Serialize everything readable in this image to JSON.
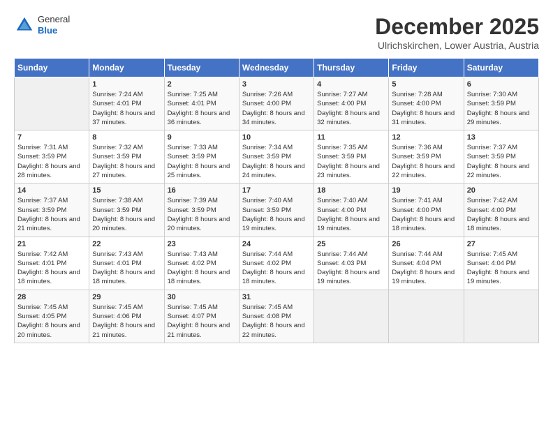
{
  "header": {
    "logo_general": "General",
    "logo_blue": "Blue",
    "month": "December 2025",
    "location": "Ulrichskirchen, Lower Austria, Austria"
  },
  "days_of_week": [
    "Sunday",
    "Monday",
    "Tuesday",
    "Wednesday",
    "Thursday",
    "Friday",
    "Saturday"
  ],
  "weeks": [
    [
      {
        "day": "",
        "info": ""
      },
      {
        "day": "1",
        "info": "Sunrise: 7:24 AM\nSunset: 4:01 PM\nDaylight: 8 hours and 37 minutes."
      },
      {
        "day": "2",
        "info": "Sunrise: 7:25 AM\nSunset: 4:01 PM\nDaylight: 8 hours and 36 minutes."
      },
      {
        "day": "3",
        "info": "Sunrise: 7:26 AM\nSunset: 4:00 PM\nDaylight: 8 hours and 34 minutes."
      },
      {
        "day": "4",
        "info": "Sunrise: 7:27 AM\nSunset: 4:00 PM\nDaylight: 8 hours and 32 minutes."
      },
      {
        "day": "5",
        "info": "Sunrise: 7:28 AM\nSunset: 4:00 PM\nDaylight: 8 hours and 31 minutes."
      },
      {
        "day": "6",
        "info": "Sunrise: 7:30 AM\nSunset: 3:59 PM\nDaylight: 8 hours and 29 minutes."
      }
    ],
    [
      {
        "day": "7",
        "info": "Sunrise: 7:31 AM\nSunset: 3:59 PM\nDaylight: 8 hours and 28 minutes."
      },
      {
        "day": "8",
        "info": "Sunrise: 7:32 AM\nSunset: 3:59 PM\nDaylight: 8 hours and 27 minutes."
      },
      {
        "day": "9",
        "info": "Sunrise: 7:33 AM\nSunset: 3:59 PM\nDaylight: 8 hours and 25 minutes."
      },
      {
        "day": "10",
        "info": "Sunrise: 7:34 AM\nSunset: 3:59 PM\nDaylight: 8 hours and 24 minutes."
      },
      {
        "day": "11",
        "info": "Sunrise: 7:35 AM\nSunset: 3:59 PM\nDaylight: 8 hours and 23 minutes."
      },
      {
        "day": "12",
        "info": "Sunrise: 7:36 AM\nSunset: 3:59 PM\nDaylight: 8 hours and 22 minutes."
      },
      {
        "day": "13",
        "info": "Sunrise: 7:37 AM\nSunset: 3:59 PM\nDaylight: 8 hours and 22 minutes."
      }
    ],
    [
      {
        "day": "14",
        "info": "Sunrise: 7:37 AM\nSunset: 3:59 PM\nDaylight: 8 hours and 21 minutes."
      },
      {
        "day": "15",
        "info": "Sunrise: 7:38 AM\nSunset: 3:59 PM\nDaylight: 8 hours and 20 minutes."
      },
      {
        "day": "16",
        "info": "Sunrise: 7:39 AM\nSunset: 3:59 PM\nDaylight: 8 hours and 20 minutes."
      },
      {
        "day": "17",
        "info": "Sunrise: 7:40 AM\nSunset: 3:59 PM\nDaylight: 8 hours and 19 minutes."
      },
      {
        "day": "18",
        "info": "Sunrise: 7:40 AM\nSunset: 4:00 PM\nDaylight: 8 hours and 19 minutes."
      },
      {
        "day": "19",
        "info": "Sunrise: 7:41 AM\nSunset: 4:00 PM\nDaylight: 8 hours and 18 minutes."
      },
      {
        "day": "20",
        "info": "Sunrise: 7:42 AM\nSunset: 4:00 PM\nDaylight: 8 hours and 18 minutes."
      }
    ],
    [
      {
        "day": "21",
        "info": "Sunrise: 7:42 AM\nSunset: 4:01 PM\nDaylight: 8 hours and 18 minutes."
      },
      {
        "day": "22",
        "info": "Sunrise: 7:43 AM\nSunset: 4:01 PM\nDaylight: 8 hours and 18 minutes."
      },
      {
        "day": "23",
        "info": "Sunrise: 7:43 AM\nSunset: 4:02 PM\nDaylight: 8 hours and 18 minutes."
      },
      {
        "day": "24",
        "info": "Sunrise: 7:44 AM\nSunset: 4:02 PM\nDaylight: 8 hours and 18 minutes."
      },
      {
        "day": "25",
        "info": "Sunrise: 7:44 AM\nSunset: 4:03 PM\nDaylight: 8 hours and 19 minutes."
      },
      {
        "day": "26",
        "info": "Sunrise: 7:44 AM\nSunset: 4:04 PM\nDaylight: 8 hours and 19 minutes."
      },
      {
        "day": "27",
        "info": "Sunrise: 7:45 AM\nSunset: 4:04 PM\nDaylight: 8 hours and 19 minutes."
      }
    ],
    [
      {
        "day": "28",
        "info": "Sunrise: 7:45 AM\nSunset: 4:05 PM\nDaylight: 8 hours and 20 minutes."
      },
      {
        "day": "29",
        "info": "Sunrise: 7:45 AM\nSunset: 4:06 PM\nDaylight: 8 hours and 21 minutes."
      },
      {
        "day": "30",
        "info": "Sunrise: 7:45 AM\nSunset: 4:07 PM\nDaylight: 8 hours and 21 minutes."
      },
      {
        "day": "31",
        "info": "Sunrise: 7:45 AM\nSunset: 4:08 PM\nDaylight: 8 hours and 22 minutes."
      },
      {
        "day": "",
        "info": ""
      },
      {
        "day": "",
        "info": ""
      },
      {
        "day": "",
        "info": ""
      }
    ]
  ]
}
